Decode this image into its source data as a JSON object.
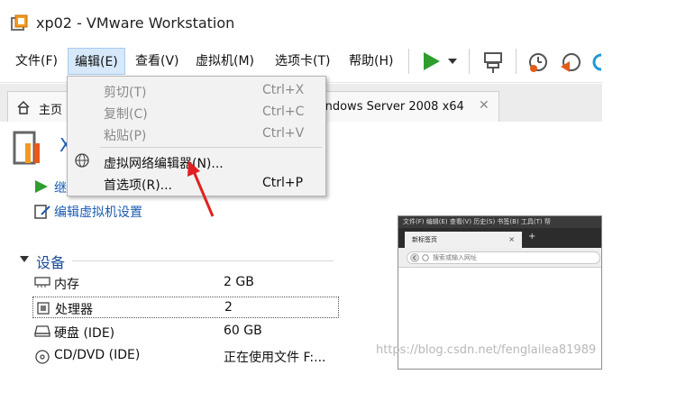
{
  "window": {
    "title": "xp02 - VMware Workstation"
  },
  "menubar": {
    "items": [
      "文件(F)",
      "编辑(E)",
      "查看(V)",
      "虚拟机(M)",
      "选项卡(T)",
      "帮助(H)"
    ]
  },
  "tabs": {
    "home_label": "主页",
    "vm_tab_label": "indows Server 2008 x64"
  },
  "vm_panel": {
    "title_partial": "X",
    "power_on_link_partial": "继",
    "edit_settings_link": "编辑虚拟机设置"
  },
  "devices": {
    "section_title": "设备",
    "rows": [
      {
        "name": "内存",
        "value": "2 GB",
        "icon": "memory-icon"
      },
      {
        "name": "处理器",
        "value": "2",
        "icon": "cpu-icon"
      },
      {
        "name": "硬盘 (IDE)",
        "value": "60 GB",
        "icon": "hard-disk-icon"
      },
      {
        "name": "CD/DVD (IDE)",
        "value": "正在使用文件 F:...",
        "icon": "cd-dvd-icon"
      }
    ]
  },
  "edit_menu": {
    "items": [
      {
        "label": "剪切(T)",
        "shortcut": "Ctrl+X",
        "enabled": false
      },
      {
        "label": "复制(C)",
        "shortcut": "Ctrl+C",
        "enabled": false
      },
      {
        "label": "粘贴(P)",
        "shortcut": "Ctrl+V",
        "enabled": false
      },
      {
        "label": "虚拟网络编辑器(N)...",
        "shortcut": "",
        "enabled": true
      },
      {
        "label": "首选项(R)...",
        "shortcut": "Ctrl+P",
        "enabled": true
      }
    ]
  },
  "thumbnail": {
    "menu_text": "文件(F)  编辑(E)  查看(V)  历史(S)  书签(B)  工具(T)  帮",
    "tab_label": "新标签页",
    "tab_close": "×",
    "new_tab": "+",
    "url_placeholder": "搜索或输入网址"
  },
  "watermark": "https://blog.csdn.net/fenglailea81989",
  "colors": {
    "link": "#1a5bb4",
    "accent_green": "#2e9d2e",
    "annotation_arrow": "#e02020"
  }
}
